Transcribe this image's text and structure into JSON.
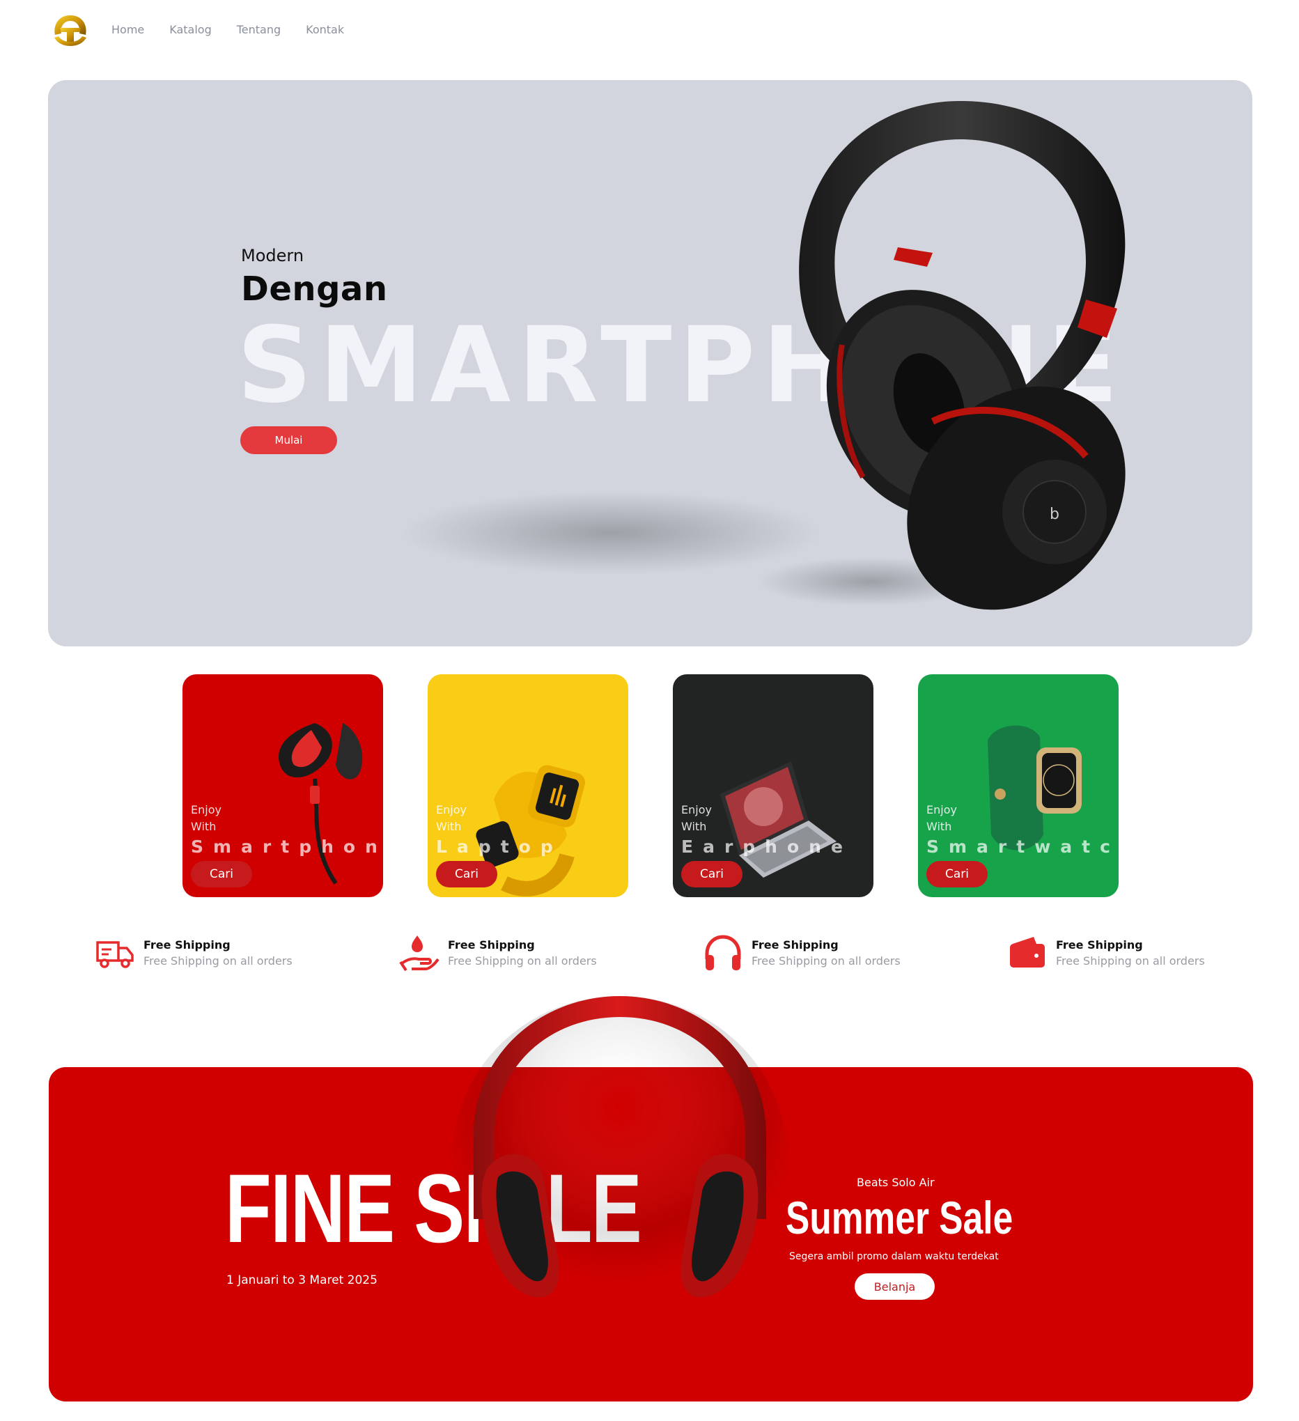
{
  "nav": {
    "links": [
      "Home",
      "Katalog",
      "Tentang",
      "Kontak"
    ]
  },
  "hero": {
    "line1": "Modern",
    "line2": "Dengan",
    "big_word": "SMARTPHONE",
    "button": "Mulai"
  },
  "cards": [
    {
      "enjoy": "Enjoy",
      "with": "With",
      "word": "Smartphone",
      "button": "Cari",
      "color": "#d10000",
      "image": "earphone-icon"
    },
    {
      "enjoy": "Enjoy",
      "with": "With",
      "word": "Laptop",
      "button": "Cari",
      "color": "#f9cc16",
      "image": "smartwatch-icon"
    },
    {
      "enjoy": "Enjoy",
      "with": "With",
      "word": "Earphone",
      "button": "Cari",
      "color": "#222424",
      "image": "laptop-icon"
    },
    {
      "enjoy": "Enjoy",
      "with": "With",
      "word": "Smartwatch",
      "button": "Cari",
      "color": "#16a34a",
      "image": "smartwatch-icon"
    }
  ],
  "features": [
    {
      "title": "Free Shipping",
      "subtitle": "Free Shipping on all orders",
      "icon": "truck-icon"
    },
    {
      "title": "Free Shipping",
      "subtitle": "Free Shipping on all orders",
      "icon": "hand-drop-icon"
    },
    {
      "title": "Free Shipping",
      "subtitle": "Free Shipping on all orders",
      "icon": "headphones-icon"
    },
    {
      "title": "Free Shipping",
      "subtitle": "Free Shipping on all orders",
      "icon": "wallet-icon"
    }
  ],
  "sale": {
    "headline": "FINE SMILE",
    "date": "1 Januari to 3 Maret 2025",
    "product": "Beats Solo Air",
    "title": "Summer Sale",
    "subtitle": "Segera ambil promo dalam waktu terdekat",
    "button": "Belanja"
  },
  "colors": {
    "accent": "#e4393d",
    "sale_bg": "#d00000",
    "hero_bg": "#d2d5dd"
  }
}
